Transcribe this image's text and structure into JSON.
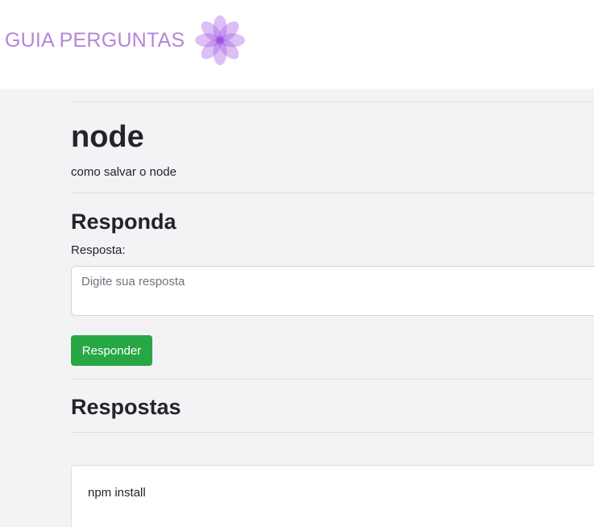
{
  "navbar": {
    "brand": "GUIA PERGUNTAS",
    "logo_icon": "lotus-flower-icon",
    "brand_color": "#b685d8"
  },
  "question": {
    "title": "node",
    "description": "como salvar o node"
  },
  "answer_form": {
    "heading": "Responda",
    "label": "Resposta:",
    "placeholder": "Digite sua resposta",
    "value": "",
    "submit_label": "Responder",
    "submit_color": "#28a745"
  },
  "answers": {
    "heading": "Respostas",
    "items": [
      {
        "text": "npm install"
      }
    ]
  }
}
